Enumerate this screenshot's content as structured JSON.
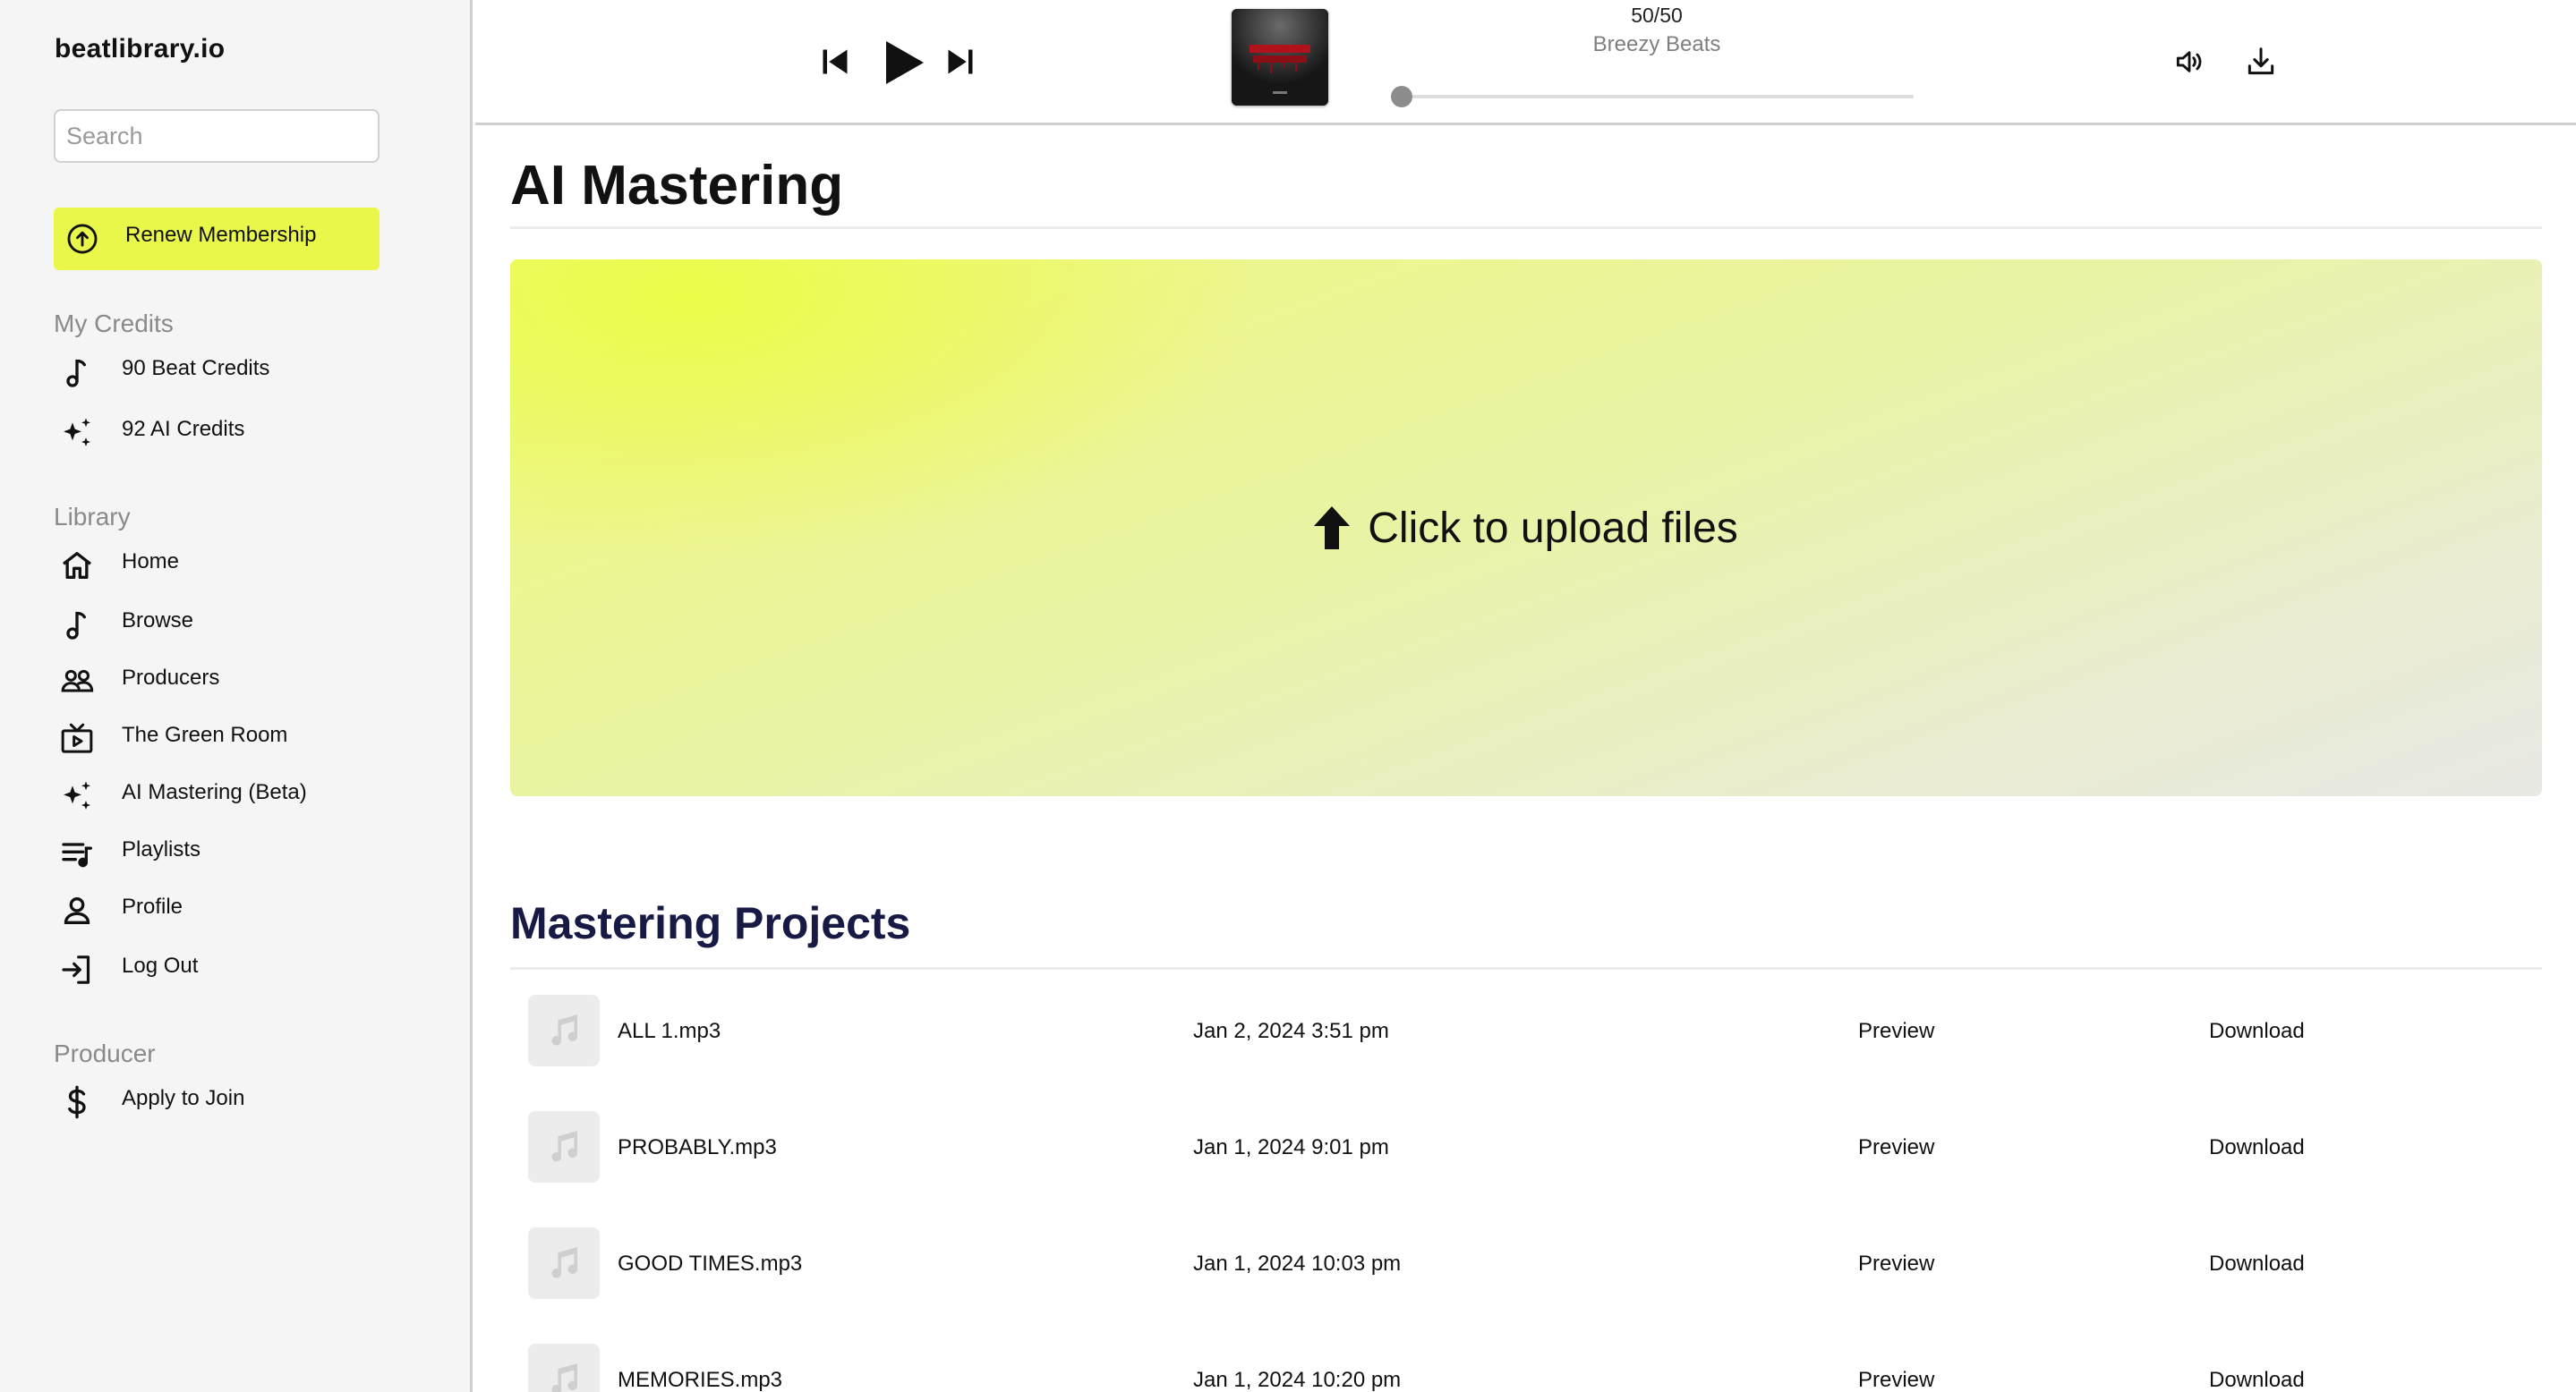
{
  "sidebar": {
    "logo": "beatlibrary.io",
    "search_placeholder": "Search",
    "renew_label": "Renew Membership",
    "accent_color": "#e8f74a",
    "credits_title": "My Credits",
    "credits": [
      {
        "label": "90 Beat Credits",
        "icon": "music-note-icon"
      },
      {
        "label": "92 AI Credits",
        "icon": "sparkles-icon"
      }
    ],
    "library_title": "Library",
    "library": [
      {
        "label": "Home",
        "icon": "home-icon"
      },
      {
        "label": "Browse",
        "icon": "music-note-icon"
      },
      {
        "label": "Producers",
        "icon": "people-icon"
      },
      {
        "label": "The Green Room",
        "icon": "tv-play-icon"
      },
      {
        "label": "AI Mastering (Beta)",
        "icon": "sparkles-icon"
      },
      {
        "label": "Playlists",
        "icon": "playlist-icon"
      },
      {
        "label": "Profile",
        "icon": "user-icon"
      },
      {
        "label": "Log Out",
        "icon": "logout-icon"
      }
    ],
    "producer_title": "Producer",
    "producer": [
      {
        "label": "Apply to Join",
        "icon": "dollar-icon"
      }
    ]
  },
  "player": {
    "track_count": "50/50",
    "artist": "Breezy Beats",
    "progress": 0.0
  },
  "main": {
    "title": "AI Mastering",
    "upload_label": "Click to upload files",
    "projects_title": "Mastering Projects",
    "projects": [
      {
        "name": "ALL 1.mp3",
        "date": "Jan 2, 2024 3:51 pm",
        "preview": "Preview",
        "download": "Download"
      },
      {
        "name": "PROBABLY.mp3",
        "date": "Jan 1, 2024 9:01 pm",
        "preview": "Preview",
        "download": "Download"
      },
      {
        "name": "GOOD TIMES.mp3",
        "date": "Jan 1, 2024 10:03 pm",
        "preview": "Preview",
        "download": "Download"
      },
      {
        "name": "MEMORIES.mp3",
        "date": "Jan 1, 2024 10:20 pm",
        "preview": "Preview",
        "download": "Download"
      }
    ]
  }
}
